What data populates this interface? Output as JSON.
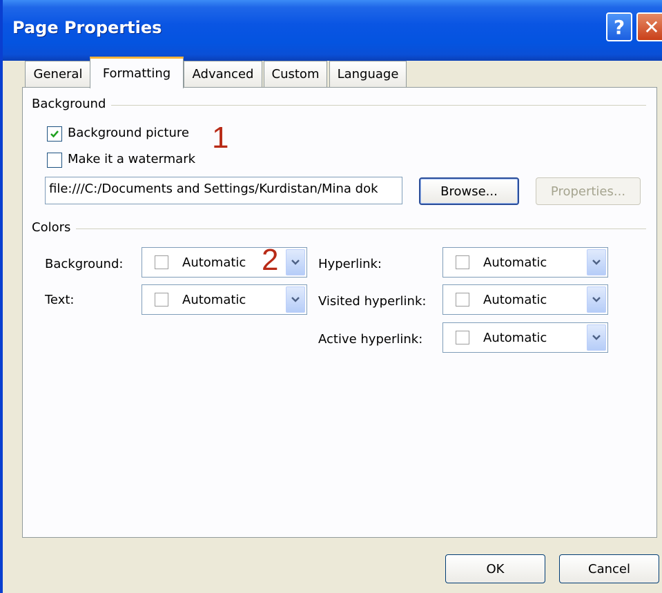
{
  "window": {
    "title": "Page Properties",
    "help_glyph": "?",
    "close_glyph": "✕"
  },
  "tabs": [
    {
      "label": "General"
    },
    {
      "label": "Formatting"
    },
    {
      "label": "Advanced"
    },
    {
      "label": "Custom"
    },
    {
      "label": "Language"
    }
  ],
  "background_group": {
    "label": "Background",
    "background_picture": {
      "label": "Background picture",
      "checked": true
    },
    "watermark": {
      "label": "Make it a watermark",
      "checked": false
    },
    "path_value": "file:///C:/Documents and Settings/Kurdistan/Mina dok",
    "browse_label": "Browse...",
    "properties_label": "Properties..."
  },
  "colors_group": {
    "label": "Colors",
    "background": {
      "label": "Background:",
      "value": "Automatic"
    },
    "text": {
      "label": "Text:",
      "value": "Automatic"
    },
    "hyperlink": {
      "label": "Hyperlink:",
      "value": "Automatic"
    },
    "visited_hyperlink": {
      "label": "Visited hyperlink:",
      "value": "Automatic"
    },
    "active_hyperlink": {
      "label": "Active hyperlink:",
      "value": "Automatic"
    }
  },
  "annotations": {
    "one": "1",
    "two": "2"
  },
  "footer": {
    "ok_label": "OK",
    "cancel_label": "Cancel"
  },
  "colors": {
    "titlebar": "#0454e0",
    "dialog_bg": "#ece9d8",
    "panel_bg": "#fcfcfe",
    "tab_accent": "#f7b43a",
    "annotation": "#b82a16"
  }
}
